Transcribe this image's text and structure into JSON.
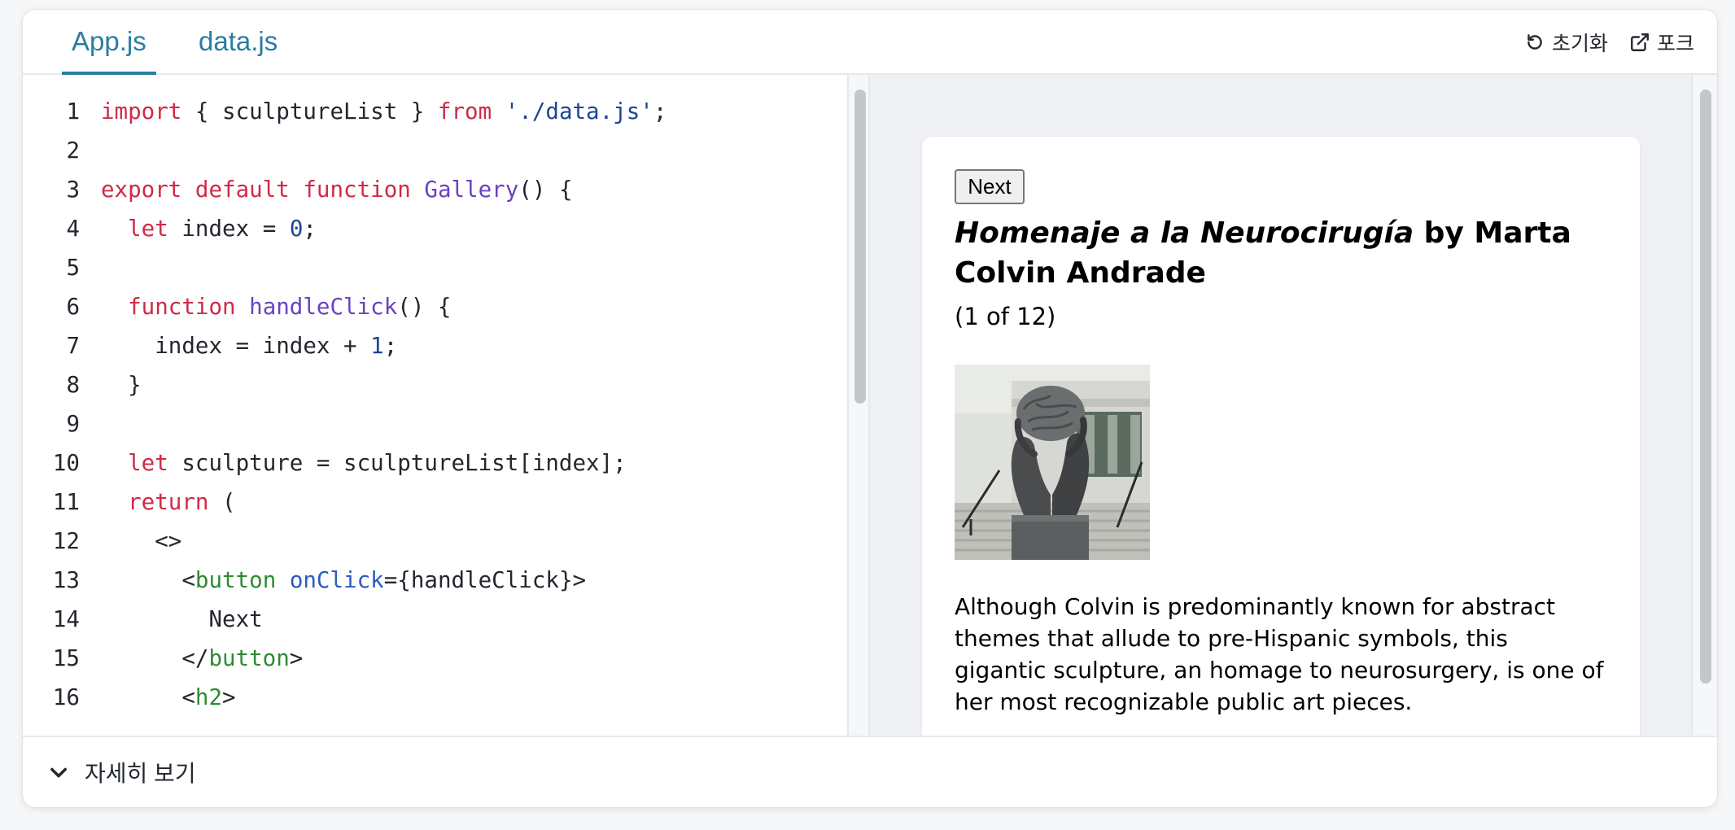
{
  "tabs": [
    {
      "label": "App.js",
      "active": true
    },
    {
      "label": "data.js",
      "active": false
    }
  ],
  "actions": {
    "reset_label": "초기화",
    "reset_icon": "reset-icon",
    "fork_label": "포크",
    "fork_icon": "external-link-icon"
  },
  "code_lines": [
    {
      "n": "1",
      "tokens": [
        {
          "t": "import",
          "c": "kw"
        },
        {
          "t": " { sculptureList } ",
          "c": "code"
        },
        {
          "t": "from",
          "c": "kw"
        },
        {
          "t": " ",
          "c": "code"
        },
        {
          "t": "'./data.js'",
          "c": "str"
        },
        {
          "t": ";",
          "c": "code"
        }
      ]
    },
    {
      "n": "2",
      "tokens": []
    },
    {
      "n": "3",
      "tokens": [
        {
          "t": "export",
          "c": "kw"
        },
        {
          "t": " ",
          "c": "code"
        },
        {
          "t": "default",
          "c": "kw"
        },
        {
          "t": " ",
          "c": "code"
        },
        {
          "t": "function",
          "c": "kw"
        },
        {
          "t": " ",
          "c": "code"
        },
        {
          "t": "Gallery",
          "c": "fn"
        },
        {
          "t": "() {",
          "c": "code"
        }
      ]
    },
    {
      "n": "4",
      "tokens": [
        {
          "t": "  ",
          "c": "code"
        },
        {
          "t": "let",
          "c": "kw"
        },
        {
          "t": " index = ",
          "c": "code"
        },
        {
          "t": "0",
          "c": "num"
        },
        {
          "t": ";",
          "c": "code"
        }
      ]
    },
    {
      "n": "5",
      "tokens": []
    },
    {
      "n": "6",
      "tokens": [
        {
          "t": "  ",
          "c": "code"
        },
        {
          "t": "function",
          "c": "kw"
        },
        {
          "t": " ",
          "c": "code"
        },
        {
          "t": "handleClick",
          "c": "fn"
        },
        {
          "t": "() {",
          "c": "code"
        }
      ]
    },
    {
      "n": "7",
      "tokens": [
        {
          "t": "    index = index + ",
          "c": "code"
        },
        {
          "t": "1",
          "c": "num"
        },
        {
          "t": ";",
          "c": "code"
        }
      ]
    },
    {
      "n": "8",
      "tokens": [
        {
          "t": "  }",
          "c": "code"
        }
      ]
    },
    {
      "n": "9",
      "tokens": []
    },
    {
      "n": "10",
      "tokens": [
        {
          "t": "  ",
          "c": "code"
        },
        {
          "t": "let",
          "c": "kw"
        },
        {
          "t": " sculpture = sculptureList[index];",
          "c": "code"
        }
      ]
    },
    {
      "n": "11",
      "tokens": [
        {
          "t": "  ",
          "c": "code"
        },
        {
          "t": "return",
          "c": "kw"
        },
        {
          "t": " (",
          "c": "code"
        }
      ]
    },
    {
      "n": "12",
      "tokens": [
        {
          "t": "    <>",
          "c": "code"
        }
      ]
    },
    {
      "n": "13",
      "tokens": [
        {
          "t": "      <",
          "c": "code"
        },
        {
          "t": "button",
          "c": "tag"
        },
        {
          "t": " ",
          "c": "code"
        },
        {
          "t": "onClick",
          "c": "attr"
        },
        {
          "t": "={handleClick}>",
          "c": "code"
        }
      ]
    },
    {
      "n": "14",
      "tokens": [
        {
          "t": "        Next",
          "c": "code"
        }
      ]
    },
    {
      "n": "15",
      "tokens": [
        {
          "t": "      </",
          "c": "code"
        },
        {
          "t": "button",
          "c": "tag"
        },
        {
          "t": ">",
          "c": "code"
        }
      ]
    },
    {
      "n": "16",
      "tokens": [
        {
          "t": "      <",
          "c": "code"
        },
        {
          "t": "h2",
          "c": "tag"
        },
        {
          "t": ">",
          "c": "code"
        }
      ]
    }
  ],
  "preview": {
    "button_label": "Next",
    "title_italic": "Homenaje a la Neurocirugía",
    "title_rest": " by Marta Colvin Andrade",
    "counter": "(1 of 12)",
    "image_subject": "sculpture-photo",
    "description": "Although Colvin is predominantly known for abstract themes that allude to pre-Hispanic symbols, this gigantic sculpture, an homage to neurosurgery, is one of her most recognizable public art pieces."
  },
  "footer": {
    "toggle_label": "자세히 보기",
    "toggle_icon": "chevron-down-icon"
  },
  "colors": {
    "tab_accent": "#2a7ea0",
    "keyword": "#d02a48",
    "function": "#6a42c2",
    "string": "#1c4596",
    "tag": "#2f8a33",
    "attribute": "#2b5bbd"
  }
}
